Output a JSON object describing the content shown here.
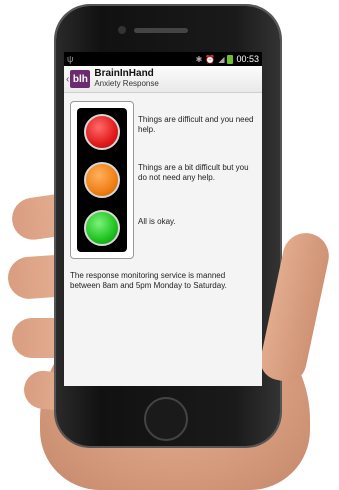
{
  "status": {
    "left_icon": "usb-icon",
    "icons": [
      "bluetooth-icon",
      "alarm-icon",
      "signal-icon",
      "battery-icon"
    ],
    "time": "00:53"
  },
  "app": {
    "logo": "blh",
    "title": "BrainInHand",
    "subtitle": "Anxiety Response"
  },
  "lights": [
    {
      "color": "red",
      "text": "Things are difficult and you need help."
    },
    {
      "color": "orange",
      "text": "Things are a bit difficult but you do not need any help."
    },
    {
      "color": "green",
      "text": "All is okay."
    }
  ],
  "note": "The response monitoring service is manned between 8am and 5pm Monday to Saturday.",
  "colors": {
    "brand": "#6a2c6e",
    "red": "#e21b1b",
    "orange": "#f08013",
    "green": "#1fc21f"
  }
}
